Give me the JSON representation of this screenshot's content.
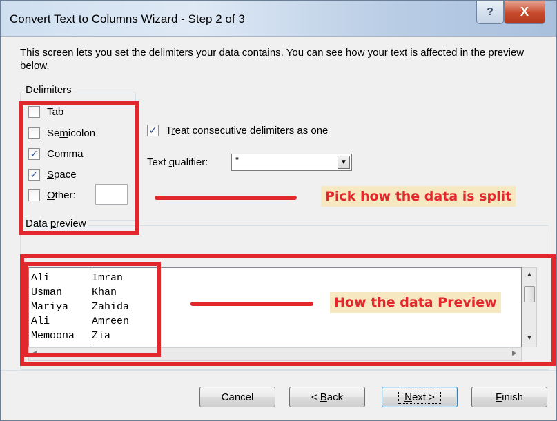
{
  "window": {
    "title": "Convert Text to Columns Wizard - Step 2 of 3",
    "help_glyph": "?",
    "close_glyph": "X"
  },
  "intro_text": "This screen lets you set the delimiters your data contains.  You can see how your text is affected in the preview below.",
  "delimiters": {
    "label": "Delimiters",
    "items": [
      {
        "label": "Tab",
        "checked": false
      },
      {
        "label": "Semicolon",
        "checked": false
      },
      {
        "label": "Comma",
        "checked": true
      },
      {
        "label": "Space",
        "checked": true
      },
      {
        "label": "Other:",
        "checked": false
      }
    ],
    "other_value": ""
  },
  "options": {
    "consecutive_label": "Treat consecutive delimiters as one",
    "consecutive_checked": true,
    "qualifier_label": "Text qualifier:",
    "qualifier_value": "\""
  },
  "preview": {
    "label": "Data preview",
    "rows": [
      [
        "Ali",
        "Imran"
      ],
      [
        "Usman",
        "Khan"
      ],
      [
        "Mariya",
        "Zahida"
      ],
      [
        "Ali",
        "Amreen"
      ],
      [
        "Memoona",
        "Zia"
      ]
    ]
  },
  "buttons": {
    "cancel": "Cancel",
    "back": "< Back",
    "next": "Next >",
    "finish": "Finish"
  },
  "annotations": {
    "split_note": "Pick how the data is split",
    "preview_note": "How the data Preview"
  },
  "colors": {
    "annotation_red": "#e2272d",
    "annotation_bg": "#f6e8c0",
    "checkmark": "#2e4f8c"
  },
  "icons": {
    "help": "help-icon",
    "close": "close-icon",
    "dropdown": "chevron-down-icon",
    "scroll_up": "arrow-up-icon",
    "scroll_down": "arrow-down-icon"
  }
}
